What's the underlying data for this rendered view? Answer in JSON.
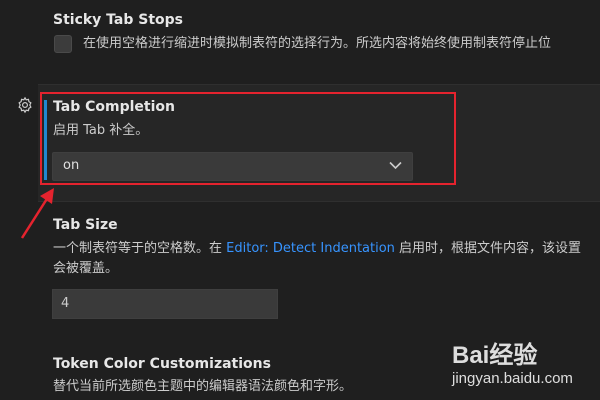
{
  "settings": {
    "sticky_tab_stops": {
      "title": "Sticky Tab Stops",
      "description": "在使用空格进行缩进时模拟制表符的选择行为。所选内容将始终使用制表符停止位"
    },
    "tab_completion": {
      "title": "Tab Completion",
      "description": "启用 Tab 补全。",
      "value": "on"
    },
    "tab_size": {
      "title": "Tab Size",
      "desc_before": "一个制表符等于的空格数。在 ",
      "desc_link": "Editor: Detect Indentation",
      "desc_after": " 启用时，根据文件内容，该设置",
      "desc_line2": "会被覆盖。",
      "value": "4"
    },
    "token_color": {
      "title": "Token Color Customizations",
      "description": "替代当前所选颜色主题中的编辑器语法颜色和字形。"
    }
  },
  "icons": {
    "gear": "gear-icon",
    "chevron": "chevron-down-icon",
    "checkbox": "checkbox-icon"
  },
  "annotation": {
    "color": "#e5232e"
  },
  "watermark": {
    "brand": "Bai经验",
    "url": "jingyan.baidu.com"
  },
  "colors": {
    "background": "#1f1f1f",
    "link": "#3794ff",
    "focus_bar": "#2188d1"
  }
}
